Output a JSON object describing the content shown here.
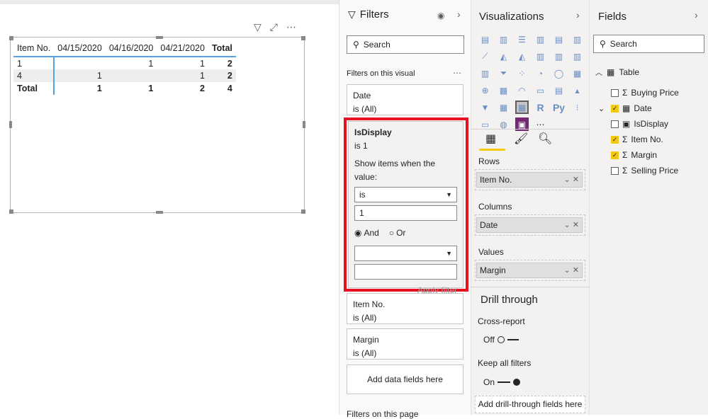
{
  "visual": {
    "columns": [
      "Item No.",
      "04/15/2020",
      "04/16/2020",
      "04/21/2020",
      "Total"
    ],
    "rows": [
      [
        "1",
        "",
        "1",
        "1",
        "2"
      ],
      [
        "4",
        "1",
        "",
        "1",
        "2"
      ]
    ],
    "total": [
      "Total",
      "1",
      "1",
      "2",
      "4"
    ]
  },
  "filters": {
    "title": "Filters",
    "search_placeholder": "Search",
    "section": "Filters on this visual",
    "date": {
      "name": "Date",
      "state": "is (All)"
    },
    "isdisplay": {
      "name": "IsDisplay",
      "state": "is 1",
      "show_label": "Show items when the value:",
      "op": "is",
      "value": "1",
      "and": "And",
      "or": "Or",
      "op2": "",
      "value2": "",
      "apply": "Apply filter"
    },
    "itemno": {
      "name": "Item No.",
      "state": "is (All)"
    },
    "margin": {
      "name": "Margin",
      "state": "is (All)"
    },
    "add": "Add data fields here",
    "page_section": "Filters on this page"
  },
  "viz": {
    "title": "Visualizations",
    "more": "...",
    "rows_label": "Rows",
    "rows_field": "Item No.",
    "cols_label": "Columns",
    "cols_field": "Date",
    "values_label": "Values",
    "values_field": "Margin",
    "drill": "Drill through",
    "cross": "Cross-report",
    "cross_state": "Off",
    "keep": "Keep all filters",
    "keep_state": "On",
    "add_drill": "Add drill-through fields here"
  },
  "fields": {
    "title": "Fields",
    "search_placeholder": "Search",
    "table": "Table",
    "items": [
      {
        "name": "Buying Price",
        "checked": false,
        "icon": "sigma"
      },
      {
        "name": "Date",
        "checked": true,
        "icon": "calendar"
      },
      {
        "name": "IsDisplay",
        "checked": false,
        "icon": "calculator"
      },
      {
        "name": "Item No.",
        "checked": true,
        "icon": "sigma"
      },
      {
        "name": "Margin",
        "checked": true,
        "icon": "sigma"
      },
      {
        "name": "Selling Price",
        "checked": false,
        "icon": "sigma"
      }
    ]
  },
  "colors": {
    "highlight": "#e81123",
    "accent": "#f2c811",
    "header_line": "#56a0e6"
  }
}
